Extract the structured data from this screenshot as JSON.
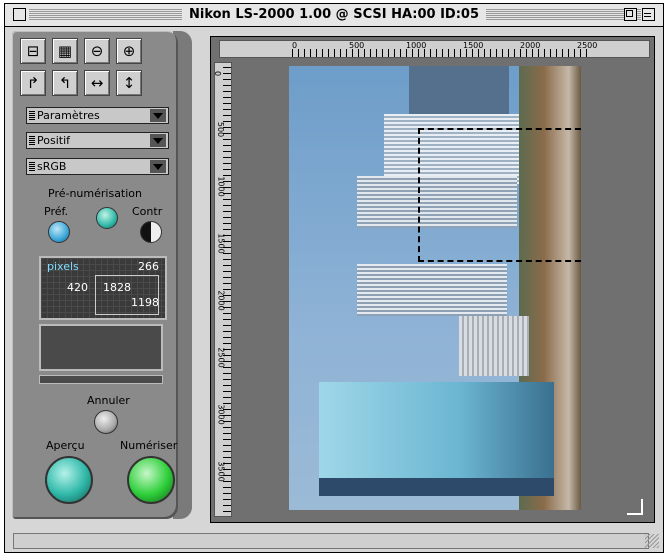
{
  "window": {
    "title": "Nikon LS-2000 1.00 @ SCSI HA:00 ID:05"
  },
  "toolbar": {
    "row1": [
      {
        "name": "scanner-icon",
        "glyph": "⊟"
      },
      {
        "name": "checker-icon",
        "glyph": "▦"
      },
      {
        "name": "zoom-out-icon",
        "glyph": "⊖"
      },
      {
        "name": "zoom-in-icon",
        "glyph": "⊕"
      }
    ],
    "row2": [
      {
        "name": "rotate-right-icon",
        "glyph": "↱"
      },
      {
        "name": "rotate-left-icon",
        "glyph": "↰"
      },
      {
        "name": "flip-horizontal-icon",
        "glyph": "↔"
      },
      {
        "name": "flip-vertical-icon",
        "glyph": "↕"
      }
    ]
  },
  "dropdowns": {
    "parametres": "Paramètres",
    "positif": "Positif",
    "srgb": "sRGB"
  },
  "prescan": {
    "title": "Pré-numérisation",
    "pref": "Préf.",
    "contr": "Contr"
  },
  "info": {
    "units": "pixels",
    "top": "266",
    "left": "420",
    "width": "1828",
    "height": "1198"
  },
  "actions": {
    "annuler": "Annuler",
    "apercu": "Aperçu",
    "numeriser": "Numériser"
  },
  "colors": {
    "pref_knob": "#3aa7d8",
    "contr_knob": "#e0e0e0",
    "apercu_knob": "#2fb8a8",
    "numeriser_knob": "#2ecf3a",
    "cancel_knob": "#a9a9a9"
  },
  "ruler": {
    "h": [
      "0",
      "500",
      "1000",
      "1500",
      "2000",
      "2500"
    ],
    "v": [
      "0",
      "500",
      "1000",
      "1500",
      "2000",
      "2500",
      "3000",
      "3500"
    ]
  }
}
